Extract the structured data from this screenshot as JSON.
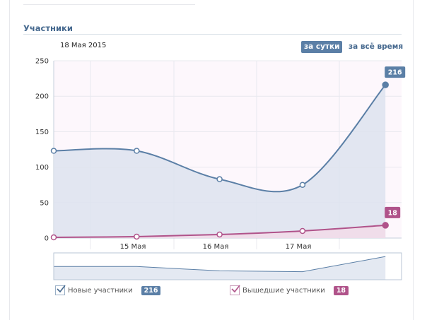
{
  "section": {
    "title": "Участники"
  },
  "header": {
    "date": "18 Мая 2015"
  },
  "period": {
    "day_label": "за сутки",
    "all_label": "за всё время"
  },
  "colors": {
    "series_new": "#5b7fa6",
    "series_left": "#b0538a",
    "fill_new": "#dde3ef",
    "fill_left": "#f2dbe9",
    "plot_bg": "#fdf7fc",
    "grid": "#e8e8ef"
  },
  "chart_data": {
    "type": "area",
    "ylim": [
      0,
      250
    ],
    "yticks": [
      "0",
      "50",
      "100",
      "150",
      "200",
      "250"
    ],
    "xticks": [
      "15 Мая",
      "16 Мая",
      "17 Мая"
    ],
    "grid": true,
    "series": [
      {
        "name": "Новые участники",
        "x": [
          0,
          1,
          2,
          3,
          4
        ],
        "values": [
          123,
          123,
          83,
          75,
          216
        ],
        "last_label": "216"
      },
      {
        "name": "Вышедшие участники",
        "x": [
          0,
          1,
          2,
          3,
          4
        ],
        "values": [
          1,
          2,
          5,
          10,
          18
        ],
        "last_label": "18"
      }
    ]
  },
  "legend": {
    "items": [
      {
        "label": "Новые участники",
        "count": "216",
        "checked": true
      },
      {
        "label": "Вышедшие участники",
        "count": "18",
        "checked": true
      }
    ]
  }
}
